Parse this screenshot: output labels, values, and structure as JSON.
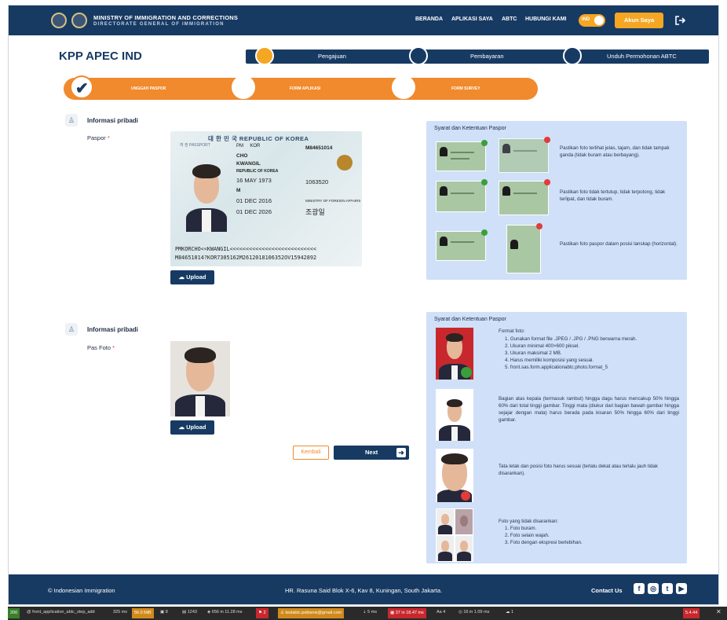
{
  "header": {
    "org_line1": "MINISTRY OF IMMIGRATION AND CORRECTIONS",
    "org_line2": "DIRECTORATE GENERAL OF IMMIGRATION",
    "nav": [
      "BERANDA",
      "APLIKASI SAYA",
      "ABTC",
      "HUBUNGI KAMI"
    ],
    "lang_toggle": "IND",
    "account_button": "Akun Saya",
    "logout_icon": "logout-icon"
  },
  "page": {
    "title": "KPP APEC IND",
    "main_steps": [
      "Pengajuan",
      "Pembayaran",
      "Unduh Permohonan ABTC"
    ],
    "sub_steps": [
      "UNGGAH PASPOR",
      "FORM APLIKASI",
      "FORM SURVEY"
    ]
  },
  "passport_section": {
    "section_title": "Informasi pribadi",
    "field_label": "Paspor",
    "required_mark": "*",
    "upload_label": "Upload",
    "image": {
      "header": "대 한 민 국   REPUBLIC OF KOREA",
      "sub": "여 권  PASSPORT",
      "type": "PM",
      "country": "KOR",
      "number": "M84651014",
      "surname": "CHO",
      "given_name": "KWANGIL",
      "nationality": "REPUBLIC OF KOREA",
      "dob": "16 MAY 1973",
      "personal_no": "1063520",
      "sex": "M",
      "issue": "01 DEC 2016",
      "authority": "MINISTRY OF FOREIGN AFFAIRS",
      "expiry": "01 DEC 2026",
      "hangul_name": "조광일",
      "mrz1": "PMKORCHO<<KWANGIL<<<<<<<<<<<<<<<<<<<<<<<<<<<",
      "mrz2": "M84651014?KOR7305162M2612018106352OV15942892"
    },
    "panel": {
      "title": "Syarat dan Ketentuan Paspor",
      "items": [
        "Pastikan foto terlihat jelas, tajam, dan tidak tampak ganda (tidak buram atau berbayang).",
        "Pastikan foto tidak tertutup, tidak terpotong, tidak terlipat, dan tidak buram.",
        "Pastikan foto paspor dalam posisi lanskap (horizontal)."
      ]
    }
  },
  "photo_section": {
    "section_title": "Informasi pribadi",
    "field_label": "Pas Foto",
    "required_mark": "*",
    "upload_label": "Upload",
    "panel": {
      "title": "Syarat dan Ketentuan Paspor",
      "format_title": "Format foto:",
      "format_items": [
        "1. Gunakan format file .JPEG / .JPG / .PNG berwarna merah.",
        "2. Ukuran minimal 400×600 piksel.",
        "3. Ukuran maksimal 2 MB.",
        "4. Harus memiliki komposisi yang sesuai.",
        "5. front.sas.form.applicationabtc.photo.format_5"
      ],
      "proportion_text": "Bagian atas kepala (termasuk rambut) hingga dagu harus mencakup 50% hingga 60% dari total tinggi gambar. Tinggi mata (diukur dari bagian bawah gambar hingga sejajar dengan mata) harus berada pada kisaran 50% hingga 60% dari tinggi gambar.",
      "position_text": "Tata letak dan posisi foto harus sesuai (terlalu dekat atau terlalu jauh tidak disarankan).",
      "not_recommended_title": "Foto yang tidak disarankan:",
      "not_recommended_items": [
        "1. Foto buram.",
        "2. Foto selain wajah.",
        "3. Foto dengan ekspresi berlebihan."
      ]
    }
  },
  "actions": {
    "back": "Kembali",
    "next": "Next"
  },
  "footer": {
    "left": "© Indonesian Immigration",
    "center": "HR. Rasuna Said Blok X-6, Kav 8, Kuningan, South Jakarta.",
    "right": "Contact Us",
    "social_icons": [
      "facebook-icon",
      "instagram-icon",
      "twitter-icon",
      "youtube-icon"
    ]
  },
  "debug_bar": {
    "status": "200",
    "route": "@ front_application_abtc_step_add",
    "time": "325 ms",
    "memory": "56.0 MiB",
    "forms": "8",
    "logs": "1243",
    "cache": "656 in 11.28 ms",
    "security": "2",
    "user": "testabtc.pebisnis@gmail.com",
    "doctrine": "5 ms",
    "db": "37 in 18.47 ms",
    "translations": "4",
    "twig": "16 in 1.09 ms",
    "requests": "1",
    "version": "5.4.44",
    "colors": {
      "status": "#3a7f2b",
      "memory": "#d08a1c",
      "security": "#c8282d",
      "user": "#d08a1c",
      "db": "#c8282d"
    }
  },
  "colors": {
    "navy": "#173a63",
    "orange": "#f08a2c",
    "amber": "#f5a623",
    "panel": "#cfe0f8"
  }
}
